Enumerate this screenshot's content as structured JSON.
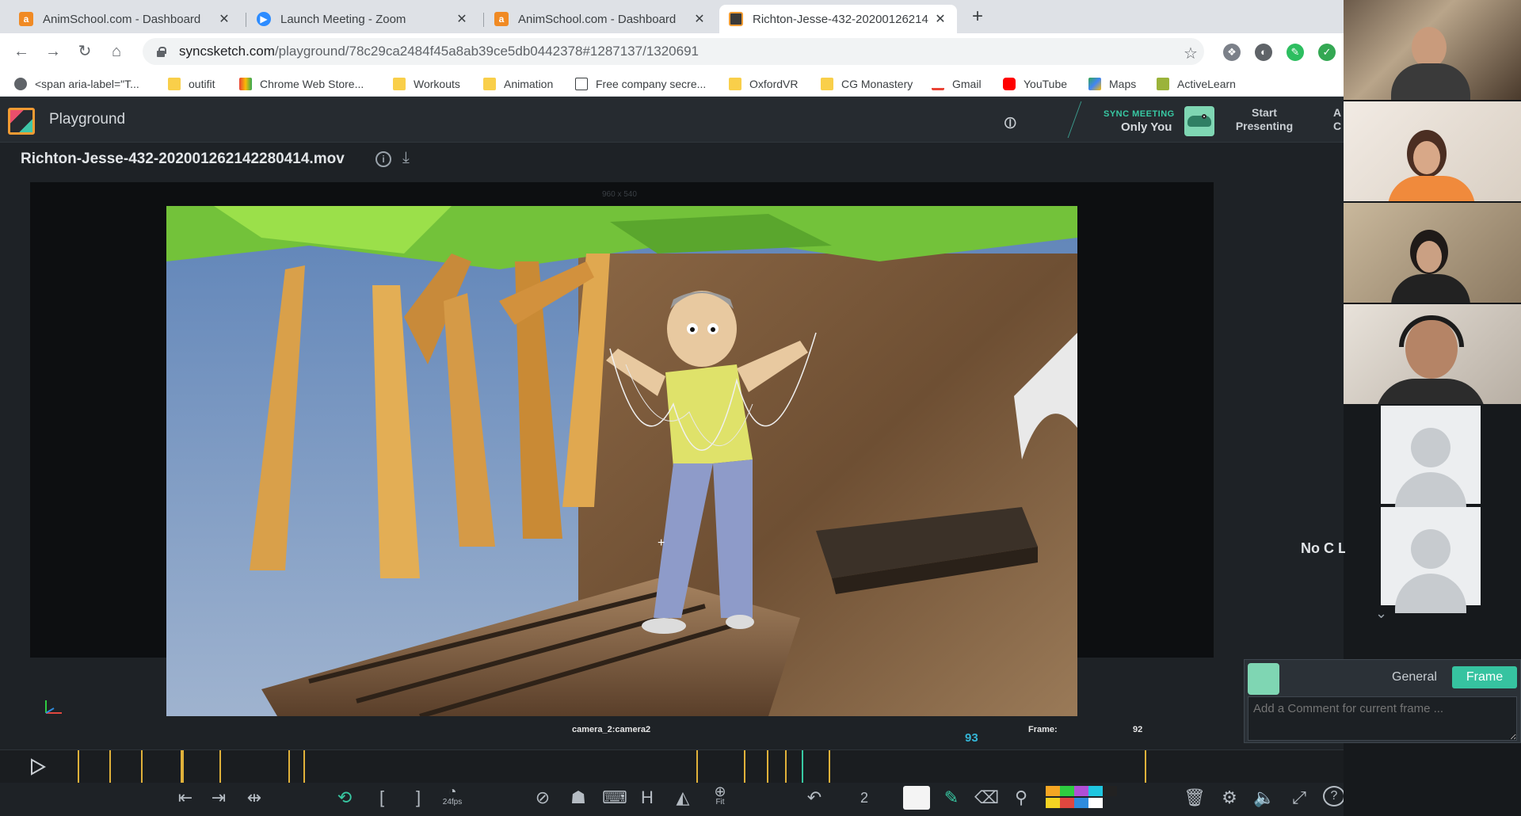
{
  "browser": {
    "tabs": [
      {
        "label": "AnimSchool.com - Dashboard",
        "favicon": "animschool-icon",
        "active": false
      },
      {
        "label": "Launch Meeting - Zoom",
        "favicon": "zoom-icon",
        "active": false
      },
      {
        "label": "AnimSchool.com - Dashboard",
        "favicon": "animschool-icon",
        "active": false
      },
      {
        "label": "Richton-Jesse-432-20200126214",
        "favicon": "syncsketch-icon",
        "active": true
      }
    ],
    "close_glyph": "✕",
    "new_tab_glyph": "+",
    "url_host": "syncsketch.com",
    "url_path": "/playground/78c29ca2484f45a8ab39ce5db0442378#1287137/1320691",
    "bookmarks": [
      {
        "label": "<span aria-label=\"T...",
        "icon": "globe-icon"
      },
      {
        "label": "outifit",
        "icon": "folder-icon"
      },
      {
        "label": "Chrome Web Store...",
        "icon": "chrome-store-icon"
      },
      {
        "label": "Workouts",
        "icon": "folder-icon"
      },
      {
        "label": "Animation",
        "icon": "folder-icon"
      },
      {
        "label": "Free company secre...",
        "icon": "id-icon"
      },
      {
        "label": "OxfordVR",
        "icon": "folder-icon"
      },
      {
        "label": "CG Monastery",
        "icon": "folder-icon"
      },
      {
        "label": "Gmail",
        "icon": "gmail-icon"
      },
      {
        "label": "YouTube",
        "icon": "youtube-icon"
      },
      {
        "label": "Maps",
        "icon": "maps-icon"
      },
      {
        "label": "ActiveLearn",
        "icon": "activelearn-icon"
      }
    ]
  },
  "app": {
    "title": "Playground",
    "sync_meeting_label": "SYNC MEETING",
    "sync_meeting_sub": "Only You",
    "start_presenting": "Start Presenting",
    "cut_text": "A C",
    "file_name": "Richton-Jesse-432-20200126214228041​4.mov",
    "info_glyph": "i",
    "download_glyph": "⤓"
  },
  "viewer": {
    "resolution_label": "960 x 540",
    "camera_label": "camera_2:camera2",
    "frame_label": "Frame:",
    "frame_value": "92",
    "marker_frame": "93"
  },
  "timeline": {
    "current_frame": "93",
    "ticks": [
      0.0,
      0.0233,
      0.0466,
      0.0755,
      0.0766,
      0.1038,
      0.1544,
      0.1655,
      0.4533,
      0.4877,
      0.5044,
      0.5177,
      0.5499,
      0.7816
    ],
    "playhead": 0.5299
  },
  "bottom_toolbar": {
    "fps_label": "24fps",
    "fit_label": "Fit",
    "hold_label": "H",
    "count_label": "2",
    "colors": [
      "#f5a623",
      "#f5d323",
      "#2ecc40",
      "#e0473f",
      "#b04fd6",
      "#2f8bdc",
      "#1fc6e0",
      "#ffffff",
      "#222222"
    ]
  },
  "comment": {
    "tab_general": "General",
    "tab_frame": "Frame",
    "placeholder": "Add a Comment for current frame ..."
  },
  "zoom": {
    "partial_text": "No C Leav",
    "chevron": "⌄"
  }
}
